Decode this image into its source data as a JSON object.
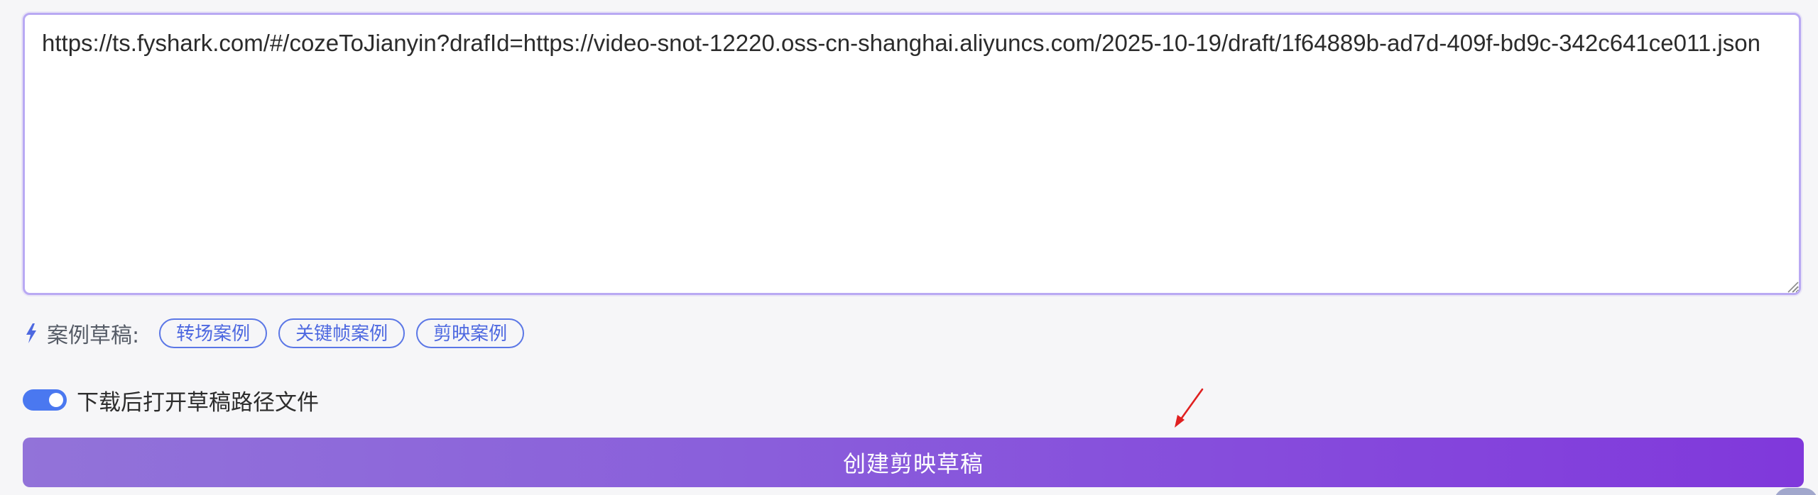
{
  "draft": {
    "url_value": "https://ts.fyshark.com/#/cozeToJianyin?drafId=https://video-snot-12220.oss-cn-shanghai.aliyuncs.com/2025-10-19/draft/1f64889b-ad7d-409f-bd9c-342c641ce011.json"
  },
  "examples": {
    "icon": "bolt-icon",
    "label": "案例草稿:",
    "chips": [
      {
        "label": "转场案例"
      },
      {
        "label": "关键帧案例"
      },
      {
        "label": "剪映案例"
      }
    ]
  },
  "options": {
    "open_folder_toggle": {
      "label": "下载后打开草稿路径文件",
      "checked": true
    }
  },
  "actions": {
    "create_label": "创建剪映草稿"
  },
  "colors": {
    "accent_blue": "#4a78f0",
    "chip_blue": "#4d68e0",
    "button_gradient_start": "#9273d9",
    "button_gradient_end": "#8038db",
    "annotation_red": "#e02020"
  }
}
